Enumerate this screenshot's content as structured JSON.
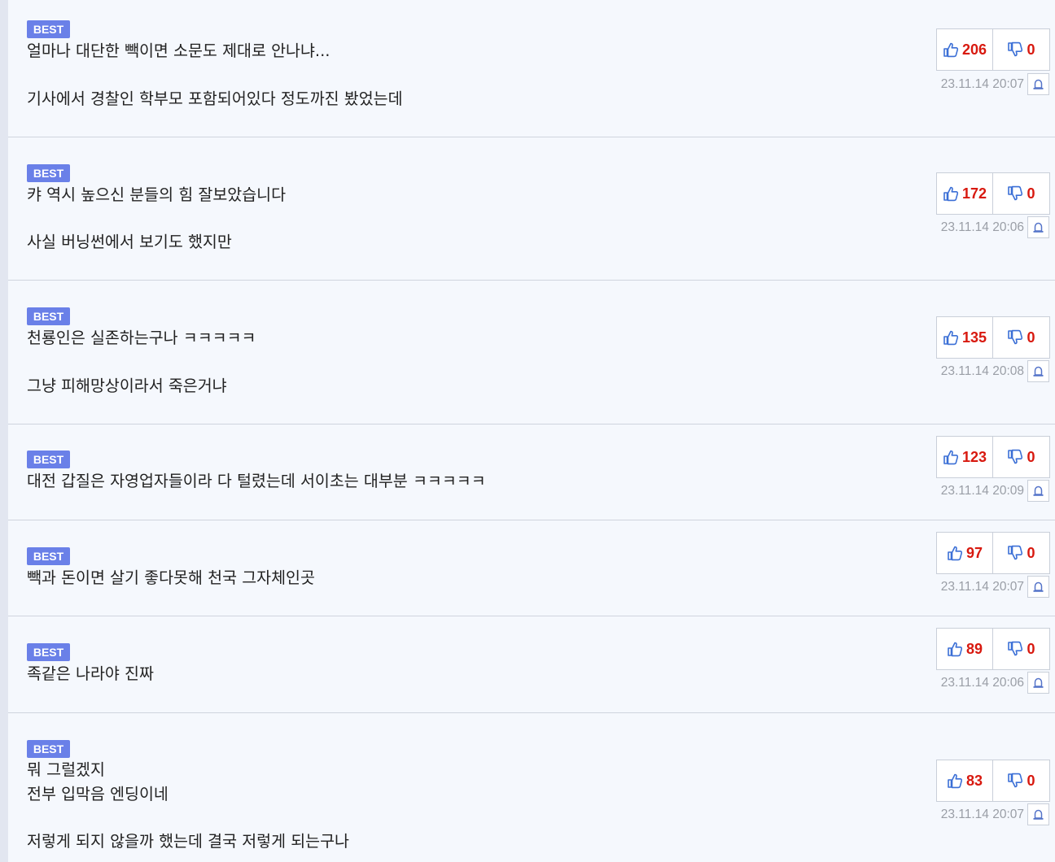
{
  "badge_label": "BEST",
  "comments": [
    {
      "lines": [
        "얼마나 대단한 빽이면 소문도 제대로 안나냐...",
        "기사에서 경찰인 학부모 포함되어있다 정도까진 봤었는데"
      ],
      "up": "206",
      "down": "0",
      "date": "23.11.14 20:07"
    },
    {
      "lines": [
        "캬 역시 높으신 분들의 힘 잘보았습니다",
        "사실 버닝썬에서 보기도 했지만"
      ],
      "up": "172",
      "down": "0",
      "date": "23.11.14 20:06"
    },
    {
      "lines": [
        "천룡인은 실존하는구나 ㅋㅋㅋㅋㅋ",
        "그냥 피해망상이라서 죽은거냐"
      ],
      "up": "135",
      "down": "0",
      "date": "23.11.14 20:08"
    },
    {
      "lines": [
        "대전 갑질은 자영업자들이라 다 털렸는데 서이초는 대부분 ㅋㅋㅋㅋㅋ"
      ],
      "up": "123",
      "down": "0",
      "date": "23.11.14 20:09"
    },
    {
      "lines": [
        "빽과 돈이면 살기 좋다못해 천국 그자체인곳"
      ],
      "up": "97",
      "down": "0",
      "date": "23.11.14 20:07"
    },
    {
      "lines": [
        "족같은 나라야 진짜"
      ],
      "up": "89",
      "down": "0",
      "date": "23.11.14 20:06"
    },
    {
      "lines": [
        "뭐 그럴겠지",
        "전부 입막음 엔딩이네",
        "저렇게 되지 않을까 했는데 결국 저렇게 되는구나"
      ],
      "up": "83",
      "down": "0",
      "date": "23.11.14 20:07"
    }
  ],
  "colors": {
    "badge": "#6a80e8",
    "vote_count": "#d8190f",
    "thumb_icon": "#3b6fd6",
    "date": "#9a9ea6"
  },
  "icons": {
    "upvote": "thumbs-up-icon",
    "downvote": "thumbs-down-icon",
    "report": "siren-icon"
  }
}
